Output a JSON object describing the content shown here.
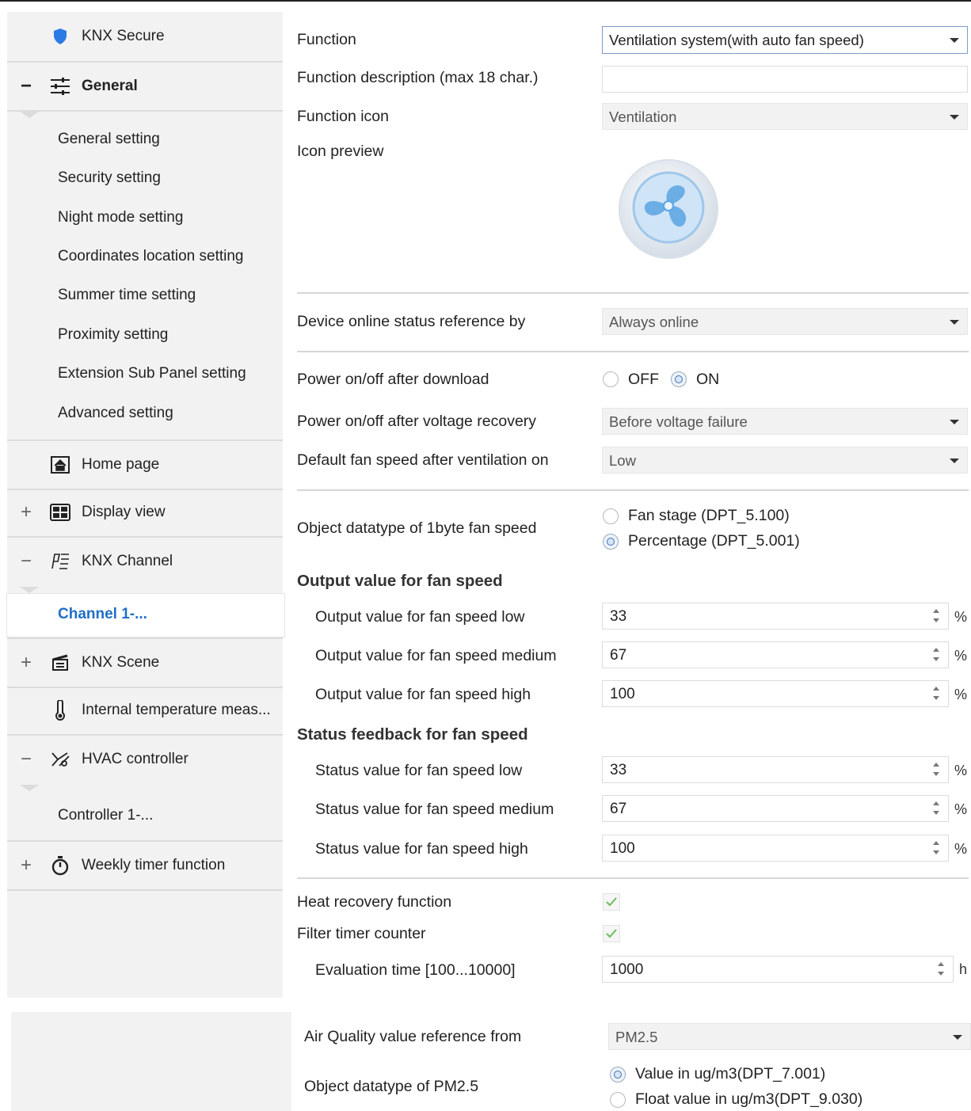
{
  "sidebar": {
    "knx_secure": "KNX Secure",
    "general": "General",
    "general_sign": "−",
    "sub_items": [
      "General setting",
      "Security setting",
      "Night mode setting",
      "Coordinates location setting",
      "Summer time setting",
      "Proximity setting",
      "Extension Sub Panel setting",
      "Advanced setting"
    ],
    "home_page": "Home page",
    "display_view": "Display view",
    "display_view_sign": "+",
    "knx_channel": "KNX Channel",
    "knx_channel_sign": "−",
    "channel_selected": "Channel 1-...",
    "knx_scene": "KNX Scene",
    "knx_scene_sign": "+",
    "internal_temp": "Internal temperature meas...",
    "hvac": "HVAC controller",
    "hvac_sign": "−",
    "controller": "Controller 1-...",
    "weekly_timer": "Weekly timer function",
    "weekly_timer_sign": "+"
  },
  "main": {
    "function_label": "Function",
    "function_value": "Ventilation system(with auto fan speed)",
    "desc_label": "Function description (max 18 char.)",
    "desc_value": "",
    "icon_label": "Function icon",
    "icon_value": "Ventilation",
    "preview_label": "Icon preview",
    "online_label": "Device online status reference by",
    "online_value": "Always online",
    "power_download_label": "Power on/off after download",
    "power_off": "OFF",
    "power_on": "ON",
    "power_voltage_label": "Power on/off after voltage recovery",
    "power_voltage_value": "Before voltage failure",
    "default_fan_label": "Default fan speed after ventilation on",
    "default_fan_value": "Low",
    "datatype_label": "Object datatype of 1byte fan speed",
    "datatype_opt1": "Fan stage (DPT_5.100)",
    "datatype_opt2": "Percentage (DPT_5.001)",
    "output_header": "Output value for fan speed",
    "output_low_label": "Output value for fan speed low",
    "output_low": "33",
    "output_med_label": "Output value for fan speed medium",
    "output_med": "67",
    "output_high_label": "Output value for fan speed high",
    "output_high": "100",
    "status_header": "Status feedback for fan speed",
    "status_low_label": "Status value for fan speed low",
    "status_low": "33",
    "status_med_label": "Status value for fan speed medium",
    "status_med": "67",
    "status_high_label": "Status value for fan speed high",
    "status_high": "100",
    "percent_unit": "%",
    "heat_recovery_label": "Heat recovery function",
    "filter_timer_label": "Filter timer counter",
    "eval_label": "Evaluation time [100...10000]",
    "eval_value": "1000",
    "eval_unit": "h",
    "air_quality_label": "Air Quality value reference from",
    "air_quality_value": "PM2.5",
    "pm_datatype_label": "Object datatype of PM2.5",
    "pm_opt1": "Value in ug/m3(DPT_7.001)",
    "pm_opt2": "Float value in ug/m3(DPT_9.030)"
  },
  "colors": {
    "accent": "#1f6fc5",
    "sidebar_bg": "#f2f2f2",
    "check": "#6dbb5e"
  }
}
